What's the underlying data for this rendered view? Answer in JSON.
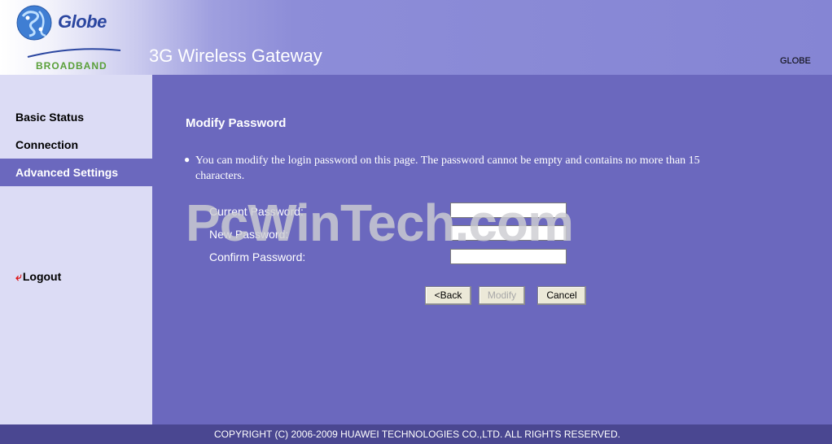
{
  "header": {
    "logo_text": "Globe",
    "logo_sub": "BROADBAND",
    "title": "3G Wireless Gateway",
    "brand": "GLOBE"
  },
  "sidebar": {
    "items": [
      {
        "label": "Basic Status"
      },
      {
        "label": "Connection"
      },
      {
        "label": "Advanced Settings"
      }
    ],
    "logout": "Logout"
  },
  "main": {
    "title": "Modify Password",
    "info": "You can modify the login password on this page. The password cannot be empty and contains no more than 15 characters.",
    "fields": [
      {
        "label": "Current Password:",
        "value": ""
      },
      {
        "label": "New Password:",
        "value": ""
      },
      {
        "label": "Confirm Password:",
        "value": ""
      }
    ],
    "buttons": {
      "back": "<Back",
      "modify": "Modify",
      "cancel": "Cancel"
    }
  },
  "watermark": "PcWinTech.com",
  "footer": {
    "copyright": "COPYRIGHT (C) 2006-2009 HUAWEI TECHNOLOGIES CO.,LTD. ALL RIGHTS RESERVED."
  }
}
